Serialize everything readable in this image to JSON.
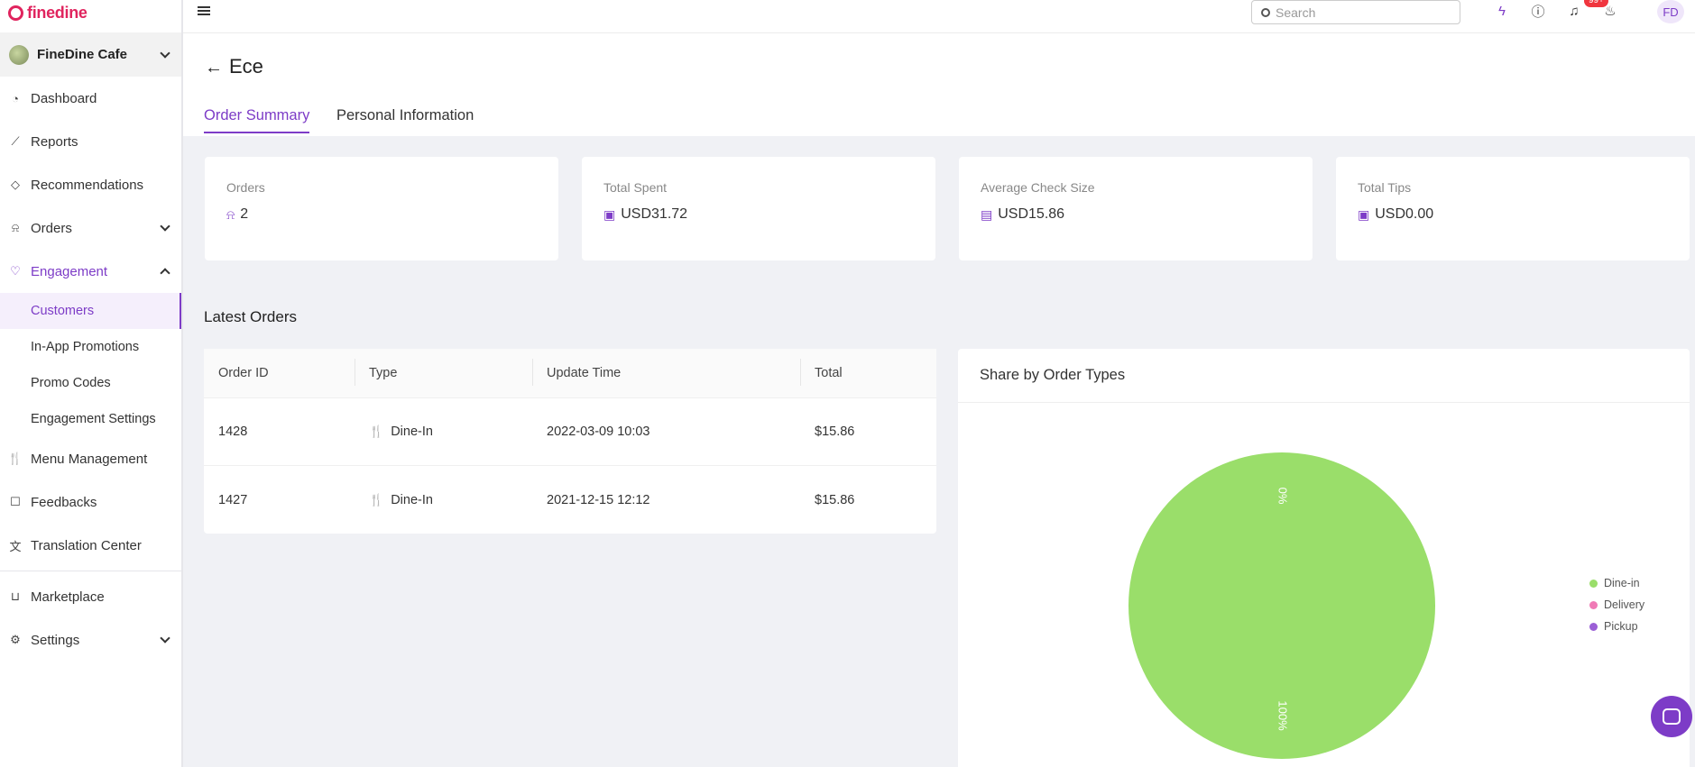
{
  "brand": {
    "logo_text": "finedine",
    "accent": "#7d3cc7",
    "brand_color": "#e0245e"
  },
  "venue": {
    "name": "FineDine Cafe"
  },
  "sidebar": {
    "items": [
      {
        "label": "Dashboard",
        "icon": "dashboard-icon"
      },
      {
        "label": "Reports",
        "icon": "chart-line-icon"
      },
      {
        "label": "Recommendations",
        "icon": "diamond-icon"
      },
      {
        "label": "Orders",
        "icon": "bell-icon"
      },
      {
        "label": "Engagement",
        "icon": "heart-icon"
      },
      {
        "label": "Menu Management",
        "icon": "fork-knife-icon"
      },
      {
        "label": "Feedbacks",
        "icon": "chat-icon"
      },
      {
        "label": "Translation Center",
        "icon": "translate-icon"
      },
      {
        "label": "Marketplace",
        "icon": "cart-icon"
      },
      {
        "label": "Settings",
        "icon": "gear-icon"
      }
    ],
    "engagement_sub": [
      "Customers",
      "In-App Promotions",
      "Promo Codes",
      "Engagement Settings"
    ]
  },
  "topbar": {
    "search_placeholder": "Search",
    "notification_badge": "99+",
    "user_initials": "FD"
  },
  "page": {
    "title": "Ece",
    "tabs": [
      "Order Summary",
      "Personal Information"
    ]
  },
  "stats": [
    {
      "label": "Orders",
      "value": "2",
      "icon": "bell-icon"
    },
    {
      "label": "Total Spent",
      "value": "USD31.72",
      "icon": "wallet-icon"
    },
    {
      "label": "Average Check Size",
      "value": "USD15.86",
      "icon": "receipt-icon"
    },
    {
      "label": "Total Tips",
      "value": "USD0.00",
      "icon": "wallet-icon"
    }
  ],
  "latest_orders": {
    "title": "Latest Orders",
    "columns": [
      "Order ID",
      "Type",
      "Update Time",
      "Total"
    ],
    "rows": [
      {
        "id": "1428",
        "type": "Dine-In",
        "time": "2022-03-09 10:03",
        "total": "$15.86"
      },
      {
        "id": "1427",
        "type": "Dine-In",
        "time": "2021-12-15 12:12",
        "total": "$15.86"
      }
    ]
  },
  "share_chart": {
    "title": "Share by Order Types"
  },
  "chart_data": {
    "type": "pie",
    "categories": [
      "Dine-in",
      "Delivery",
      "Pickup"
    ],
    "values": [
      100,
      0,
      0
    ],
    "colors": [
      "#9ade6a",
      "#f07ab6",
      "#9b5fd6"
    ],
    "slice_labels": [
      "100%",
      "0%"
    ],
    "legend_position": "right"
  }
}
